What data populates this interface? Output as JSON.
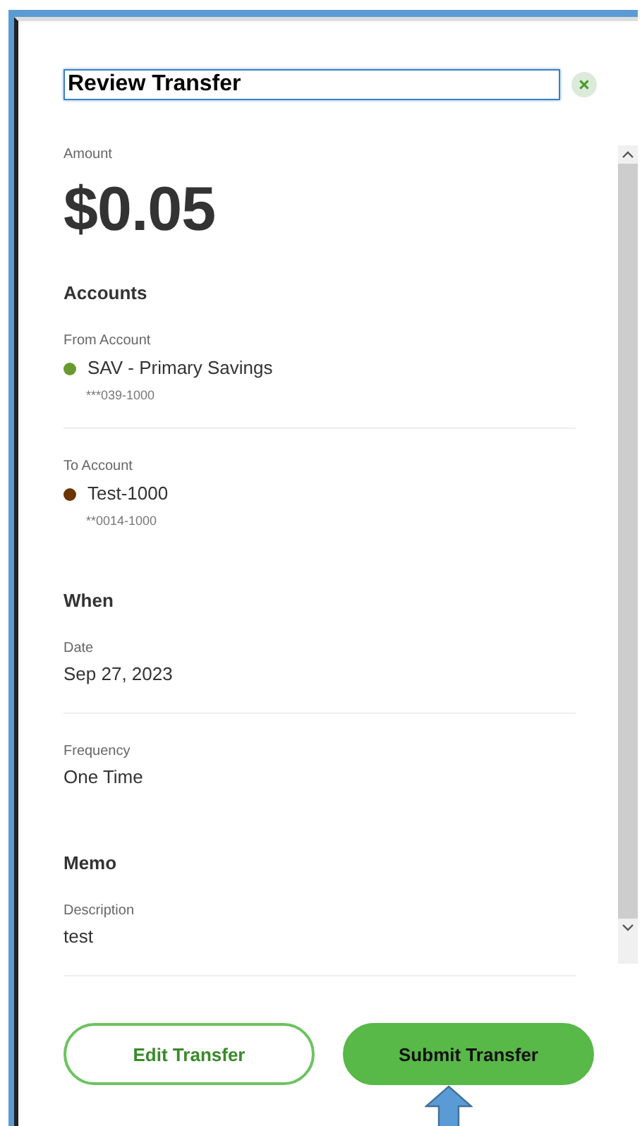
{
  "dialog": {
    "title": "Review Transfer",
    "amount": {
      "label": "Amount",
      "value": "$0.05"
    },
    "sections": [
      {
        "heading": "Accounts",
        "fields": [
          {
            "kind": "account",
            "label": "From Account",
            "value": "SAV - Primary Savings",
            "color": "#6a9a2e",
            "number": "***039-1000",
            "divider": true
          },
          {
            "kind": "account",
            "label": "To Account",
            "value": "Test-1000",
            "color": "#6b3500",
            "number": "**0014-1000",
            "divider": false
          }
        ]
      },
      {
        "heading": "When",
        "fields": [
          {
            "kind": "text",
            "label": "Date",
            "value": "Sep 27, 2023",
            "divider": true
          },
          {
            "kind": "text",
            "label": "Frequency",
            "value": "One Time",
            "divider": false
          }
        ]
      },
      {
        "heading": "Memo",
        "fields": [
          {
            "kind": "text",
            "label": "Description",
            "value": "test",
            "divider": true
          }
        ]
      }
    ],
    "buttons": [
      {
        "label": "Edit Transfer",
        "kind": "secondary"
      },
      {
        "label": "Submit Transfer",
        "kind": "primary"
      }
    ]
  }
}
